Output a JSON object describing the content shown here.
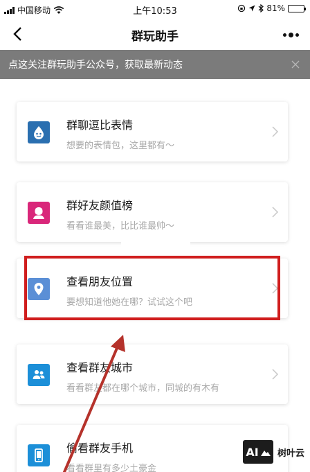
{
  "status_bar": {
    "carrier": "中国移动",
    "time": "上午10:53",
    "battery_label": "81%",
    "battery_level": 0.81
  },
  "nav": {
    "title": "群玩助手"
  },
  "banner": {
    "text": "点这关注群玩助手公众号，获取最新动态"
  },
  "features": [
    {
      "title": "群聊逗比表情",
      "subtitle": "想要的表情包，这里都有～",
      "icon": "drop-face-icon",
      "color": "#2a6fb0"
    },
    {
      "title": "群好友颜值榜",
      "subtitle": "看看谁最美，比比谁最帅～",
      "icon": "person-portrait-icon",
      "color": "#d9277a"
    },
    {
      "title": "查看朋友位置",
      "subtitle": "要想知道他她在哪？试试这个吧",
      "icon": "map-pin-icon",
      "color": "#5b8fd6"
    },
    {
      "title": "查看群友城市",
      "subtitle": "看看群友都在哪个城市，同城的有木有",
      "icon": "people-icon",
      "color": "#1c8fd8"
    },
    {
      "title": "偷看群友手机",
      "subtitle": "看看群里有多少土豪金",
      "icon": "phone-icon",
      "color": "#1c8fd8"
    }
  ],
  "annotation": {
    "highlight_color": "#d01e1e",
    "arrow_color": "#b5322b"
  },
  "watermark": {
    "text": "树叶云",
    "logo": "AI"
  }
}
